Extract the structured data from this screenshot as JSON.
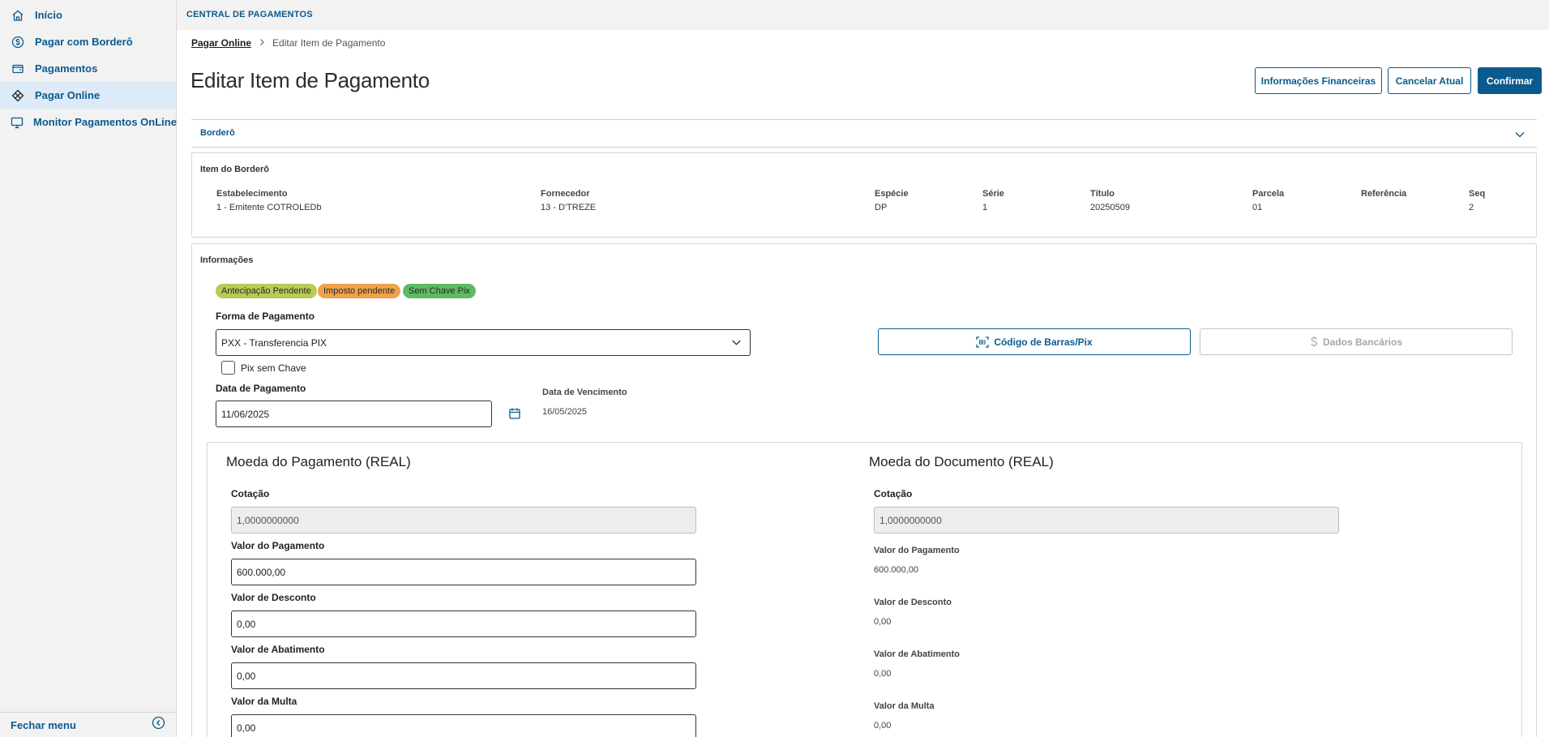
{
  "sidebar": {
    "items": [
      {
        "label": "Início",
        "icon": "home-icon"
      },
      {
        "label": "Pagar com Borderô",
        "icon": "dollar-circle-icon"
      },
      {
        "label": "Pagamentos",
        "icon": "wallet-icon"
      },
      {
        "label": "Pagar Online",
        "icon": "pix-icon"
      },
      {
        "label": "Monitor Pagamentos OnLine",
        "icon": "monitor-icon"
      }
    ],
    "active": "Pagar Online",
    "close_menu": "Fechar menu"
  },
  "topbar": {
    "title": "CENTRAL DE PAGAMENTOS"
  },
  "breadcrumb": {
    "parent": "Pagar Online",
    "current": "Editar Item de Pagamento"
  },
  "page": {
    "title": "Editar Item de Pagamento"
  },
  "actions": {
    "financial_info": "Informações Financeiras",
    "cancel": "Cancelar Atual",
    "confirm": "Confirmar"
  },
  "bordero": {
    "label": "Borderô"
  },
  "item_bordero": {
    "title": "Item do Borderô",
    "columns": [
      {
        "header": "Estabelecimento",
        "value": "1 - Emitente COTROLEDb"
      },
      {
        "header": "Fornecedor",
        "value": "13 - D'TREZE"
      },
      {
        "header": "Espécie",
        "value": "DP"
      },
      {
        "header": "Série",
        "value": "1"
      },
      {
        "header": "Título",
        "value": "20250509"
      },
      {
        "header": "Parcela",
        "value": "01"
      },
      {
        "header": "Referência",
        "value": ""
      },
      {
        "header": "Seq",
        "value": "2"
      }
    ]
  },
  "informacoes": {
    "title": "Informações",
    "tags": [
      {
        "label": "Antecipação Pendente",
        "color": "#b5cc55"
      },
      {
        "label": "Imposto pendente",
        "color": "#f0a24a"
      },
      {
        "label": "Sem Chave Pix",
        "color": "#5dbb63"
      }
    ],
    "forma_pagamento": {
      "label": "Forma de Pagamento",
      "value": "PXX - Transferencia PIX"
    },
    "pix_sem_chave": "Pix sem Chave",
    "codigo_barras": "Código de Barras/Pix",
    "dados_bancarios": "Dados Bancários",
    "data_pagamento": {
      "label": "Data de Pagamento",
      "value": "11/06/2025"
    },
    "data_vencimento": {
      "label": "Data de Vencimento",
      "value": "16/05/2025"
    }
  },
  "moeda_pagamento": {
    "title": "Moeda do Pagamento (REAL)",
    "cotacao": {
      "label": "Cotação",
      "value": "1,0000000000"
    },
    "valor_pagamento": {
      "label": "Valor do Pagamento",
      "value": "600.000,00"
    },
    "valor_desconto": {
      "label": "Valor de Desconto",
      "value": "0,00"
    },
    "valor_abatimento": {
      "label": "Valor de Abatimento",
      "value": "0,00"
    },
    "valor_multa": {
      "label": "Valor da Multa",
      "value": "0,00"
    }
  },
  "moeda_documento": {
    "title": "Moeda do Documento (REAL)",
    "cotacao": {
      "label": "Cotação",
      "value": "1,0000000000"
    },
    "valor_pagamento": {
      "label": "Valor do Pagamento",
      "value": "600.000,00"
    },
    "valor_desconto": {
      "label": "Valor de Desconto",
      "value": "0,00"
    },
    "valor_abatimento": {
      "label": "Valor de Abatimento",
      "value": "0,00"
    },
    "valor_multa": {
      "label": "Valor da Multa",
      "value": "0,00"
    }
  },
  "colors": {
    "accent": "#0b5a8e",
    "active_nav": "#dcebf7"
  }
}
